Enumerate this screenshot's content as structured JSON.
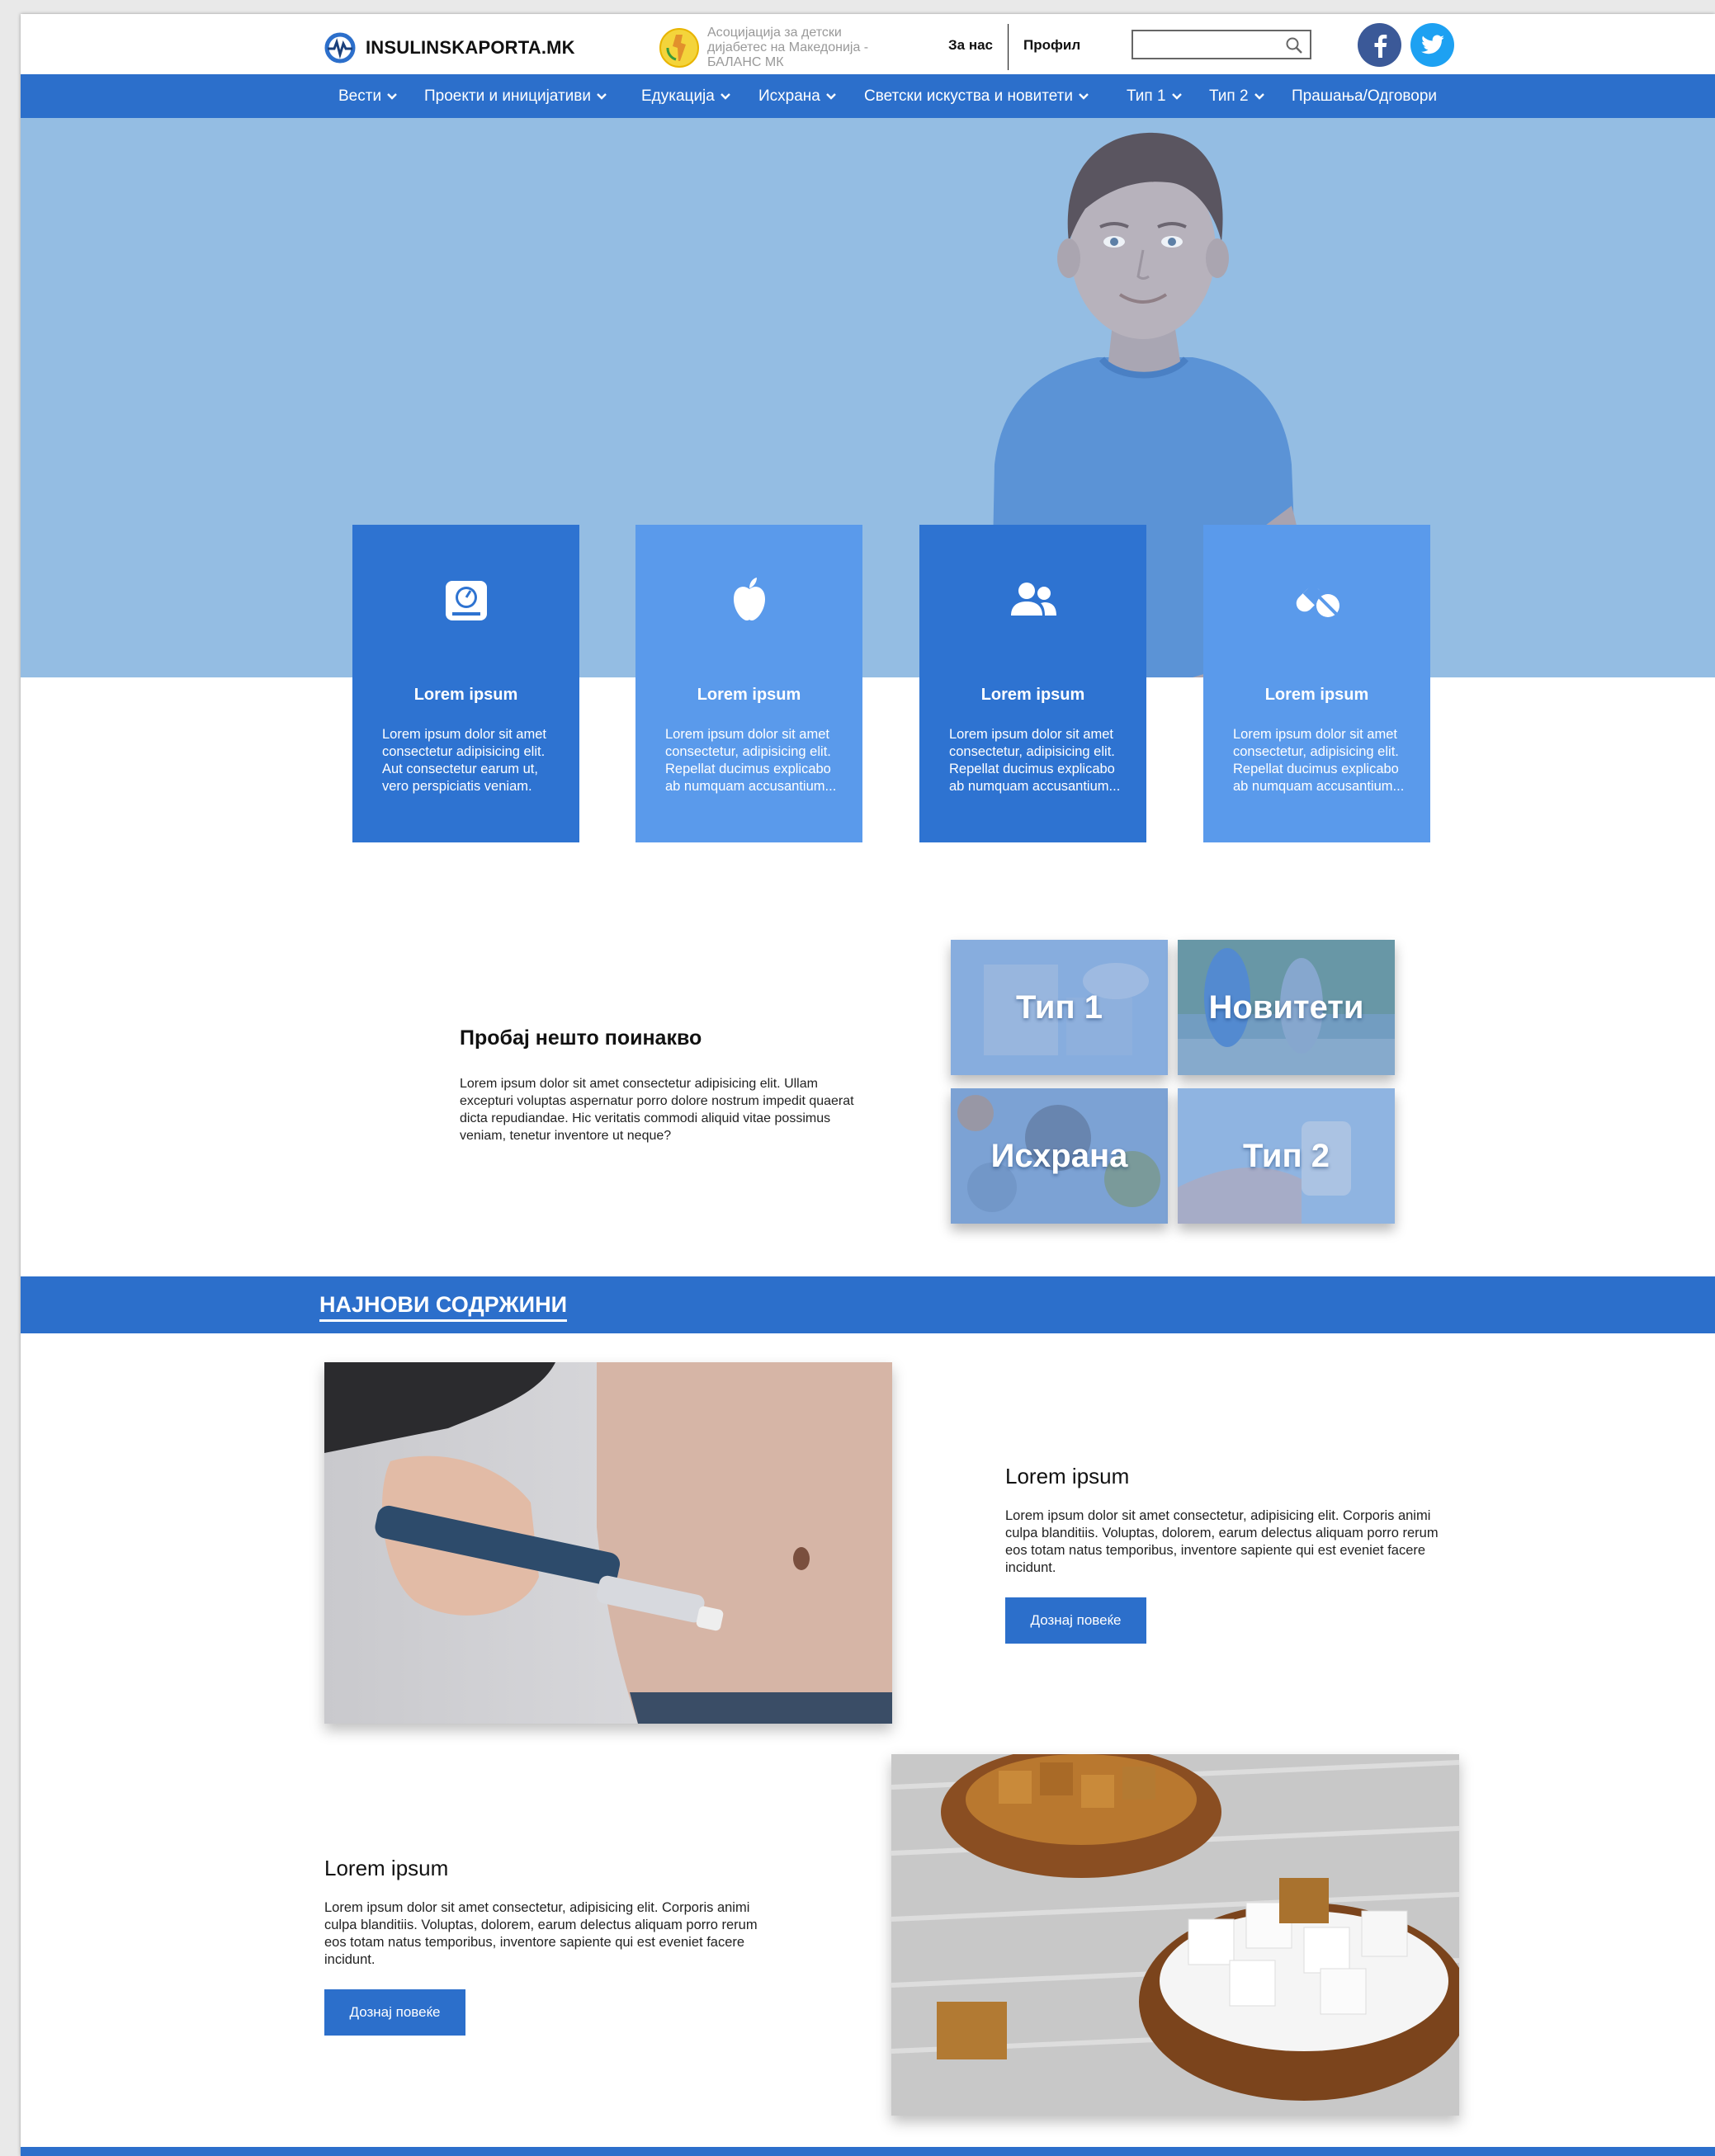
{
  "header": {
    "logo_text": "INSULINSKAPORTA.MK",
    "association_text": "Асоцијација за детски дијабетес на Македонија - БАЛАНС МК",
    "about_link": "За нас",
    "profile_link": "Профил",
    "search_placeholder": "",
    "social": [
      "facebook-icon",
      "twitter-icon"
    ]
  },
  "nav": {
    "items": [
      {
        "label": "Вести",
        "dropdown": true
      },
      {
        "label": "Проекти и иницијативи",
        "dropdown": true
      },
      {
        "label": "Едукација",
        "dropdown": true
      },
      {
        "label": "Исхрана",
        "dropdown": true
      },
      {
        "label": "Светски искуства и новитети",
        "dropdown": true
      },
      {
        "label": "Тип 1",
        "dropdown": true
      },
      {
        "label": "Тип 2",
        "dropdown": true
      },
      {
        "label": "Прашања/Одговори",
        "dropdown": false
      }
    ]
  },
  "cards": [
    {
      "icon": "scale-icon",
      "title": "Lorem ipsum",
      "text": "Lorem ipsum dolor sit amet consectetur adipisicing elit. Aut consectetur earum ut, vero perspiciatis veniam."
    },
    {
      "icon": "apple-icon",
      "title": "Lorem ipsum",
      "text": "Lorem ipsum dolor sit amet consectetur, adipisicing elit. Repellat ducimus explicabo ab numquam accusantium..."
    },
    {
      "icon": "users-icon",
      "title": "Lorem ipsum",
      "text": "Lorem ipsum dolor sit amet consectetur, adipisicing elit. Repellat ducimus explicabo ab numquam accusantium..."
    },
    {
      "icon": "pills-icon",
      "title": "Lorem ipsum",
      "text": "Lorem ipsum dolor sit amet consectetur, adipisicing elit. Repellat ducimus explicabo ab numquam accusantium..."
    }
  ],
  "try_section": {
    "title": "Пробај нешто поинакво",
    "text": "Lorem ipsum dolor sit amet consectetur adipisicing elit. Ullam excepturi voluptas aspernatur porro dolore nostrum impedit quaerat dicta repudiandae. Hic veritatis commodi aliquid vitae possimus veniam, tenetur inventore ut neque?",
    "tiles": [
      "Тип 1",
      "Новитети",
      "Исхрана",
      "Тип 2"
    ]
  },
  "latest": {
    "band_title": "НАЈНОВИ СОДРЖИНИ",
    "articles": [
      {
        "title": "Lorem ipsum",
        "text": "Lorem ipsum dolor sit amet consectetur, adipisicing elit. Corporis animi culpa blanditiis. Voluptas, dolorem, earum delectus aliquam porro rerum eos totam natus temporibus, inventore sapiente qui est eveniet facere incidunt.",
        "button": "Дознај повеќе"
      },
      {
        "title": "Lorem ipsum",
        "text": "Lorem ipsum dolor sit amet consectetur, adipisicing elit. Corporis animi culpa blanditiis. Voluptas, dolorem, earum delectus aliquam porro rerum eos totam natus temporibus, inventore sapiente qui est eveniet facere incidunt.",
        "button": "Дознај повеќе"
      }
    ]
  },
  "colors": {
    "primary": "#2c6fcb",
    "card_light": "#5a9aeb",
    "hero": "#94bde3"
  }
}
